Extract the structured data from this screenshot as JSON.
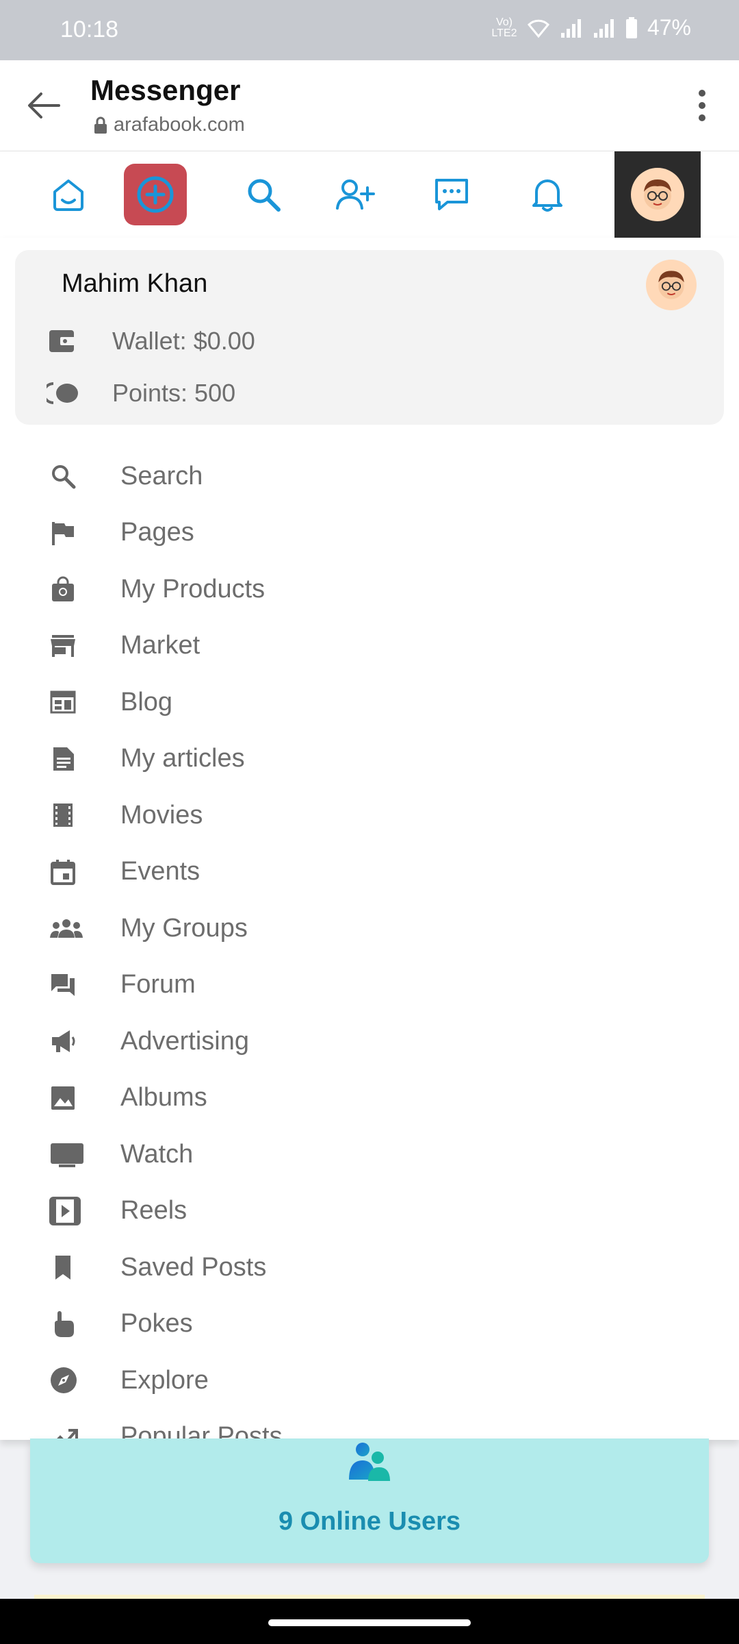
{
  "status_bar": {
    "time": "10:18",
    "network_label": "Vo) LTE2",
    "battery": "47%"
  },
  "app_bar": {
    "title": "Messenger",
    "url": "arafabook.com"
  },
  "nav": {
    "icons": [
      "home-icon",
      "add-circle-icon",
      "search-icon",
      "add-friend-icon",
      "messages-icon",
      "notifications-icon",
      "avatar"
    ]
  },
  "profile": {
    "name": "Mahim Khan",
    "wallet": "Wallet: $0.00",
    "points": "Points: 500"
  },
  "menu": {
    "items": [
      {
        "label": "Search",
        "icon": "search-icon"
      },
      {
        "label": "Pages",
        "icon": "flag-icon"
      },
      {
        "label": "My Products",
        "icon": "shopping-bag-icon"
      },
      {
        "label": "Market",
        "icon": "store-icon"
      },
      {
        "label": "Blog",
        "icon": "blog-icon"
      },
      {
        "label": "My articles",
        "icon": "article-icon"
      },
      {
        "label": "Movies",
        "icon": "film-icon"
      },
      {
        "label": "Events",
        "icon": "calendar-icon"
      },
      {
        "label": "My Groups",
        "icon": "groups-icon"
      },
      {
        "label": "Forum",
        "icon": "forum-icon"
      },
      {
        "label": "Advertising",
        "icon": "megaphone-icon"
      },
      {
        "label": "Albums",
        "icon": "image-icon"
      },
      {
        "label": "Watch",
        "icon": "tv-icon"
      },
      {
        "label": "Reels",
        "icon": "reels-icon"
      },
      {
        "label": "Saved Posts",
        "icon": "bookmark-icon"
      },
      {
        "label": "Pokes",
        "icon": "poke-icon"
      },
      {
        "label": "Explore",
        "icon": "compass-icon"
      },
      {
        "label": "Popular Posts",
        "icon": "trending-icon"
      }
    ]
  },
  "online_users": {
    "label": "9 Online Users"
  },
  "colors": {
    "accent_blue": "#1a95d8",
    "plus_red": "#c74a53",
    "online_bg": "#b2ebeb",
    "online_text": "#1a8db0"
  }
}
